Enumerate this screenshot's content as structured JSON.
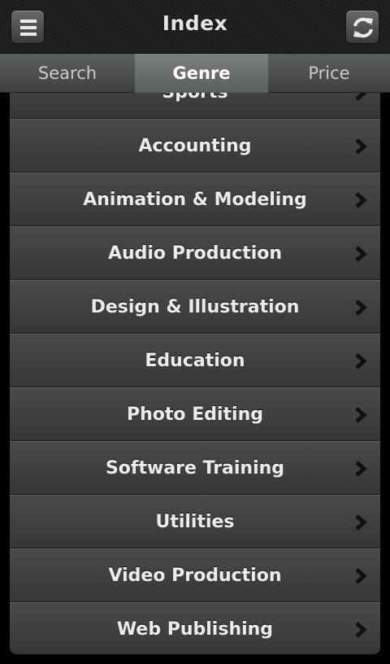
{
  "header": {
    "title": "Index",
    "menu_icon": "menu-icon",
    "refresh_icon": "refresh-icon"
  },
  "tabs": [
    {
      "label": "Search",
      "selected": false
    },
    {
      "label": "Genre",
      "selected": true
    },
    {
      "label": "Price",
      "selected": false
    }
  ],
  "genres": [
    "Sports",
    "Accounting",
    "Animation & Modeling",
    "Audio Production",
    "Design & Illustration",
    "Education",
    "Photo Editing",
    "Software Training",
    "Utilities",
    "Video Production",
    "Web Publishing"
  ],
  "colors": {
    "accent": "#5a5d5d",
    "row_bg": "#3f3f3f",
    "text": "#ececec"
  }
}
